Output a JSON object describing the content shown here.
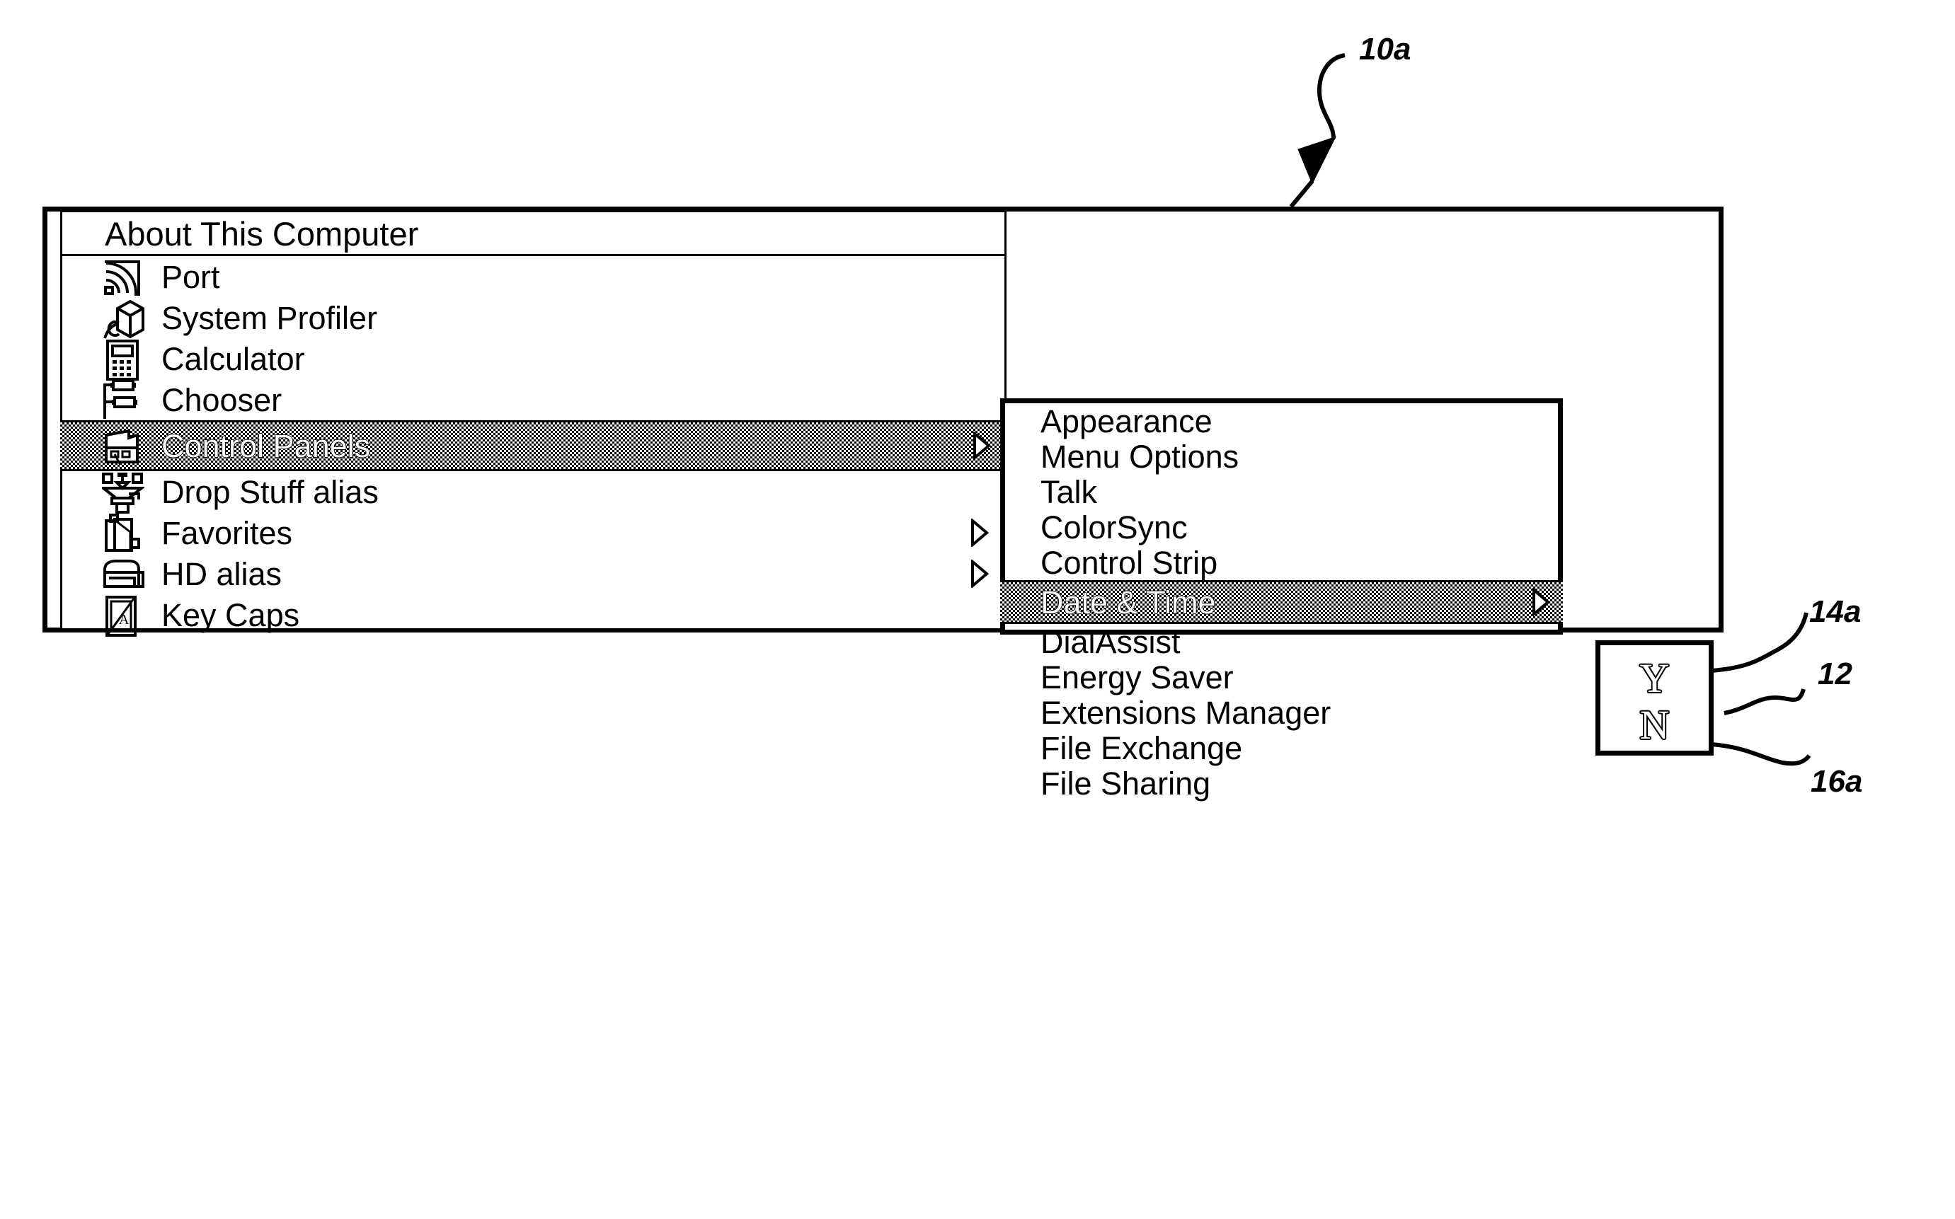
{
  "figure": {
    "reference_numerals": [
      {
        "id": "10a",
        "text": "10a"
      },
      {
        "id": "14a",
        "text": "14a"
      },
      {
        "id": "12",
        "text": "12"
      },
      {
        "id": "16a",
        "text": "16a"
      }
    ]
  },
  "apple_menu": {
    "title": "About This Computer",
    "items": [
      {
        "label": "Port",
        "icon": "port-icon",
        "submenu": false
      },
      {
        "label": "System Profiler",
        "icon": "system-profiler-icon",
        "submenu": false
      },
      {
        "label": "Calculator",
        "icon": "calculator-icon",
        "submenu": false
      },
      {
        "label": "Chooser",
        "icon": "chooser-icon",
        "submenu": false
      },
      {
        "label": "Control Panels",
        "icon": "control-panels-icon",
        "submenu": true,
        "selected": true
      },
      {
        "label": "Drop Stuff alias",
        "icon": "drop-stuff-icon",
        "submenu": false
      },
      {
        "label": "Favorites",
        "icon": "favorites-icon",
        "submenu": true
      },
      {
        "label": "HD alias",
        "icon": "hd-alias-icon",
        "submenu": true
      },
      {
        "label": "Key Caps",
        "icon": "key-caps-icon",
        "submenu": false
      }
    ]
  },
  "control_panels_menu": {
    "items": [
      {
        "label": "Appearance",
        "submenu": false
      },
      {
        "label": "Menu Options",
        "submenu": false
      },
      {
        "label": "Talk",
        "submenu": false
      },
      {
        "label": "ColorSync",
        "submenu": false
      },
      {
        "label": "Control Strip",
        "submenu": false
      },
      {
        "label": "Date & Time",
        "submenu": true,
        "selected": true
      },
      {
        "label": "DialAssist",
        "submenu": false
      },
      {
        "label": "Energy Saver",
        "submenu": false
      },
      {
        "label": "Extensions Manager",
        "submenu": false
      },
      {
        "label": "File Exchange",
        "submenu": false
      },
      {
        "label": "File Sharing",
        "submenu": false
      }
    ]
  },
  "yn_popup": {
    "yes_label": "Y",
    "no_label": "N"
  },
  "colors": {
    "ink": "#000000",
    "paper": "#ffffff"
  }
}
